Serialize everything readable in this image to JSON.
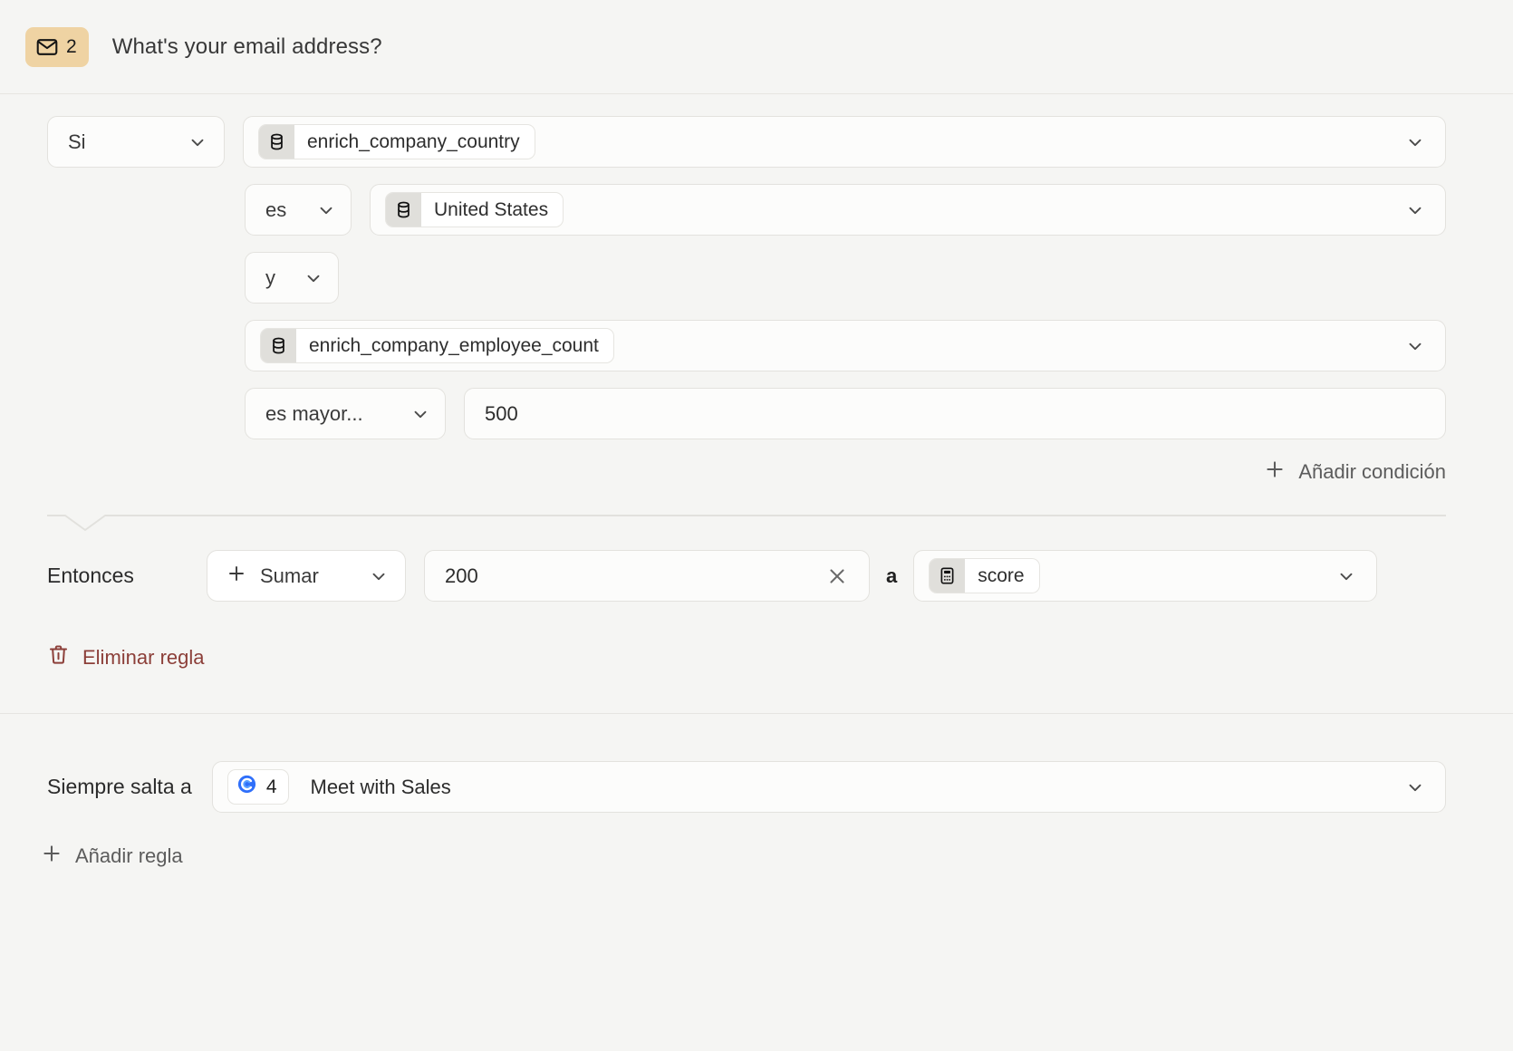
{
  "header": {
    "badge_icon": "envelope-icon",
    "badge_number": "2",
    "badge_color": "#efd3a3",
    "question_title": "What's your email address?"
  },
  "rule": {
    "if_label": "Si",
    "conditions": [
      {
        "field": "enrich_company_country",
        "field_icon": "database-icon",
        "operator": "es",
        "value": "United States",
        "value_icon": "database-icon",
        "value_kind": "pill"
      },
      {
        "joiner": "y",
        "field": "enrich_company_employee_count",
        "field_icon": "database-icon",
        "operator": "es mayor...",
        "value": "500",
        "value_kind": "text"
      }
    ],
    "add_condition_label": "Añadir condición",
    "then_label": "Entonces",
    "action_operation": "Sumar",
    "action_amount": "200",
    "action_preposition": "a",
    "action_target": "score",
    "action_target_icon": "calculator-icon",
    "delete_rule_label": "Eliminar regla",
    "delete_rule_color": "#8c3f39"
  },
  "footer": {
    "always_jump_label": "Siempre salta a",
    "jump_target_number": "4",
    "jump_target_icon": "calendly-icon",
    "jump_target_icon_color": "#2f6ffa",
    "jump_target_label": "Meet with Sales",
    "add_rule_label": "Añadir regla"
  },
  "icons": {
    "plus": "plus-icon",
    "chevron_down": "chevron-down-icon",
    "close": "close-icon",
    "trash": "trash-icon"
  }
}
